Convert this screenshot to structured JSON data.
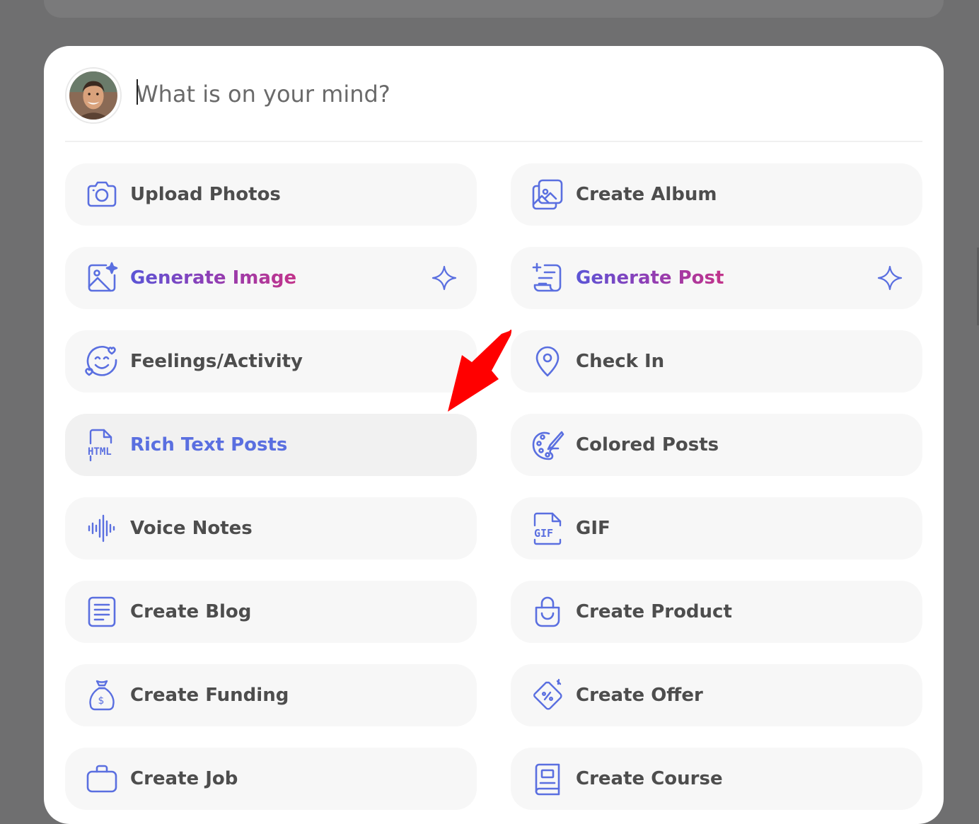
{
  "composer": {
    "placeholder": "What is on your mind?"
  },
  "options": {
    "upload_photos": "Upload Photos",
    "create_album": "Create Album",
    "generate_image": "Generate Image",
    "generate_post": "Generate Post",
    "feelings_activity": "Feelings/Activity",
    "check_in": "Check In",
    "rich_text_posts": "Rich Text Posts",
    "colored_posts": "Colored Posts",
    "voice_notes": "Voice Notes",
    "gif": "GIF",
    "create_blog": "Create Blog",
    "create_product": "Create Product",
    "create_funding": "Create Funding",
    "create_offer": "Create Offer",
    "create_job": "Create Job",
    "create_course": "Create Course"
  },
  "icons": {
    "html_text": "HTML",
    "gif_text": "GIF",
    "dollar": "$"
  },
  "colors": {
    "icon": "#5a6fe0",
    "label": "#4d4d4d",
    "highlight_label": "#5a6fe0",
    "arrow": "#ff0000",
    "overlay": "#6f6f70"
  }
}
